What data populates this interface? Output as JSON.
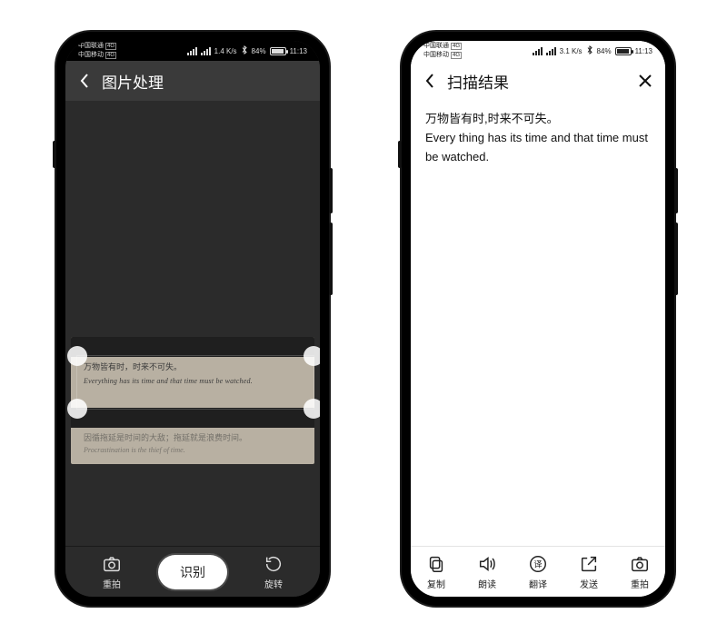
{
  "status": {
    "carrier1": "中国联通",
    "carrier2": "中国移动",
    "net_badge": "4G",
    "speed": "1.4 K/s",
    "speed2": "3.1 K/s",
    "battery": "84%",
    "time": "11:13"
  },
  "left": {
    "title": "图片处理",
    "bottom": {
      "retake": "重拍",
      "recognize": "识别",
      "rotate": "旋转"
    },
    "handwriting": {
      "l1": "万物皆有时，时来不可失。",
      "l2": "Everything has its time and that time must be watched.",
      "l3": "因循拖延是时间的大敌；拖延就是浪费时间。",
      "l4": "Procrastination is the thief of time."
    }
  },
  "right": {
    "title": "扫描结果",
    "result_cn": "万物皆有时,时来不可失。",
    "result_en": "Every thing has its time and that time must be watched.",
    "bottom": {
      "copy": "复制",
      "read": "朗读",
      "translate": "翻译",
      "send": "发送",
      "retake": "重拍"
    }
  }
}
